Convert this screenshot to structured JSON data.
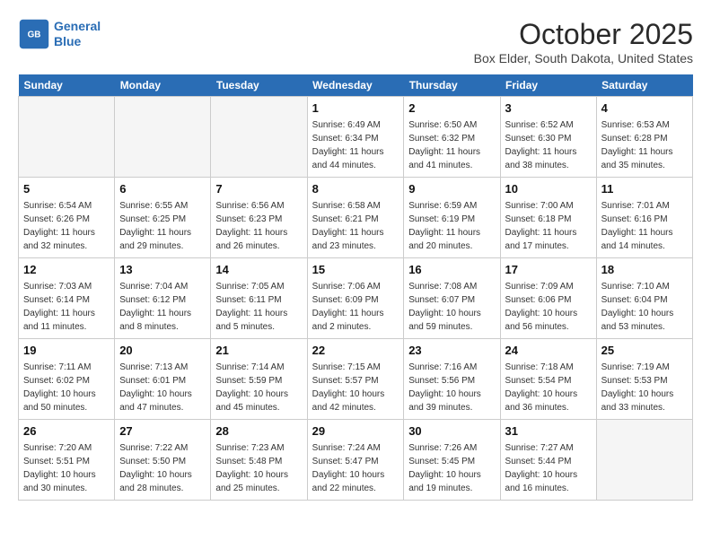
{
  "header": {
    "logo_line1": "General",
    "logo_line2": "Blue",
    "month": "October 2025",
    "location": "Box Elder, South Dakota, United States"
  },
  "weekdays": [
    "Sunday",
    "Monday",
    "Tuesday",
    "Wednesday",
    "Thursday",
    "Friday",
    "Saturday"
  ],
  "weeks": [
    [
      {
        "day": "",
        "info": ""
      },
      {
        "day": "",
        "info": ""
      },
      {
        "day": "",
        "info": ""
      },
      {
        "day": "1",
        "info": "Sunrise: 6:49 AM\nSunset: 6:34 PM\nDaylight: 11 hours\nand 44 minutes."
      },
      {
        "day": "2",
        "info": "Sunrise: 6:50 AM\nSunset: 6:32 PM\nDaylight: 11 hours\nand 41 minutes."
      },
      {
        "day": "3",
        "info": "Sunrise: 6:52 AM\nSunset: 6:30 PM\nDaylight: 11 hours\nand 38 minutes."
      },
      {
        "day": "4",
        "info": "Sunrise: 6:53 AM\nSunset: 6:28 PM\nDaylight: 11 hours\nand 35 minutes."
      }
    ],
    [
      {
        "day": "5",
        "info": "Sunrise: 6:54 AM\nSunset: 6:26 PM\nDaylight: 11 hours\nand 32 minutes."
      },
      {
        "day": "6",
        "info": "Sunrise: 6:55 AM\nSunset: 6:25 PM\nDaylight: 11 hours\nand 29 minutes."
      },
      {
        "day": "7",
        "info": "Sunrise: 6:56 AM\nSunset: 6:23 PM\nDaylight: 11 hours\nand 26 minutes."
      },
      {
        "day": "8",
        "info": "Sunrise: 6:58 AM\nSunset: 6:21 PM\nDaylight: 11 hours\nand 23 minutes."
      },
      {
        "day": "9",
        "info": "Sunrise: 6:59 AM\nSunset: 6:19 PM\nDaylight: 11 hours\nand 20 minutes."
      },
      {
        "day": "10",
        "info": "Sunrise: 7:00 AM\nSunset: 6:18 PM\nDaylight: 11 hours\nand 17 minutes."
      },
      {
        "day": "11",
        "info": "Sunrise: 7:01 AM\nSunset: 6:16 PM\nDaylight: 11 hours\nand 14 minutes."
      }
    ],
    [
      {
        "day": "12",
        "info": "Sunrise: 7:03 AM\nSunset: 6:14 PM\nDaylight: 11 hours\nand 11 minutes."
      },
      {
        "day": "13",
        "info": "Sunrise: 7:04 AM\nSunset: 6:12 PM\nDaylight: 11 hours\nand 8 minutes."
      },
      {
        "day": "14",
        "info": "Sunrise: 7:05 AM\nSunset: 6:11 PM\nDaylight: 11 hours\nand 5 minutes."
      },
      {
        "day": "15",
        "info": "Sunrise: 7:06 AM\nSunset: 6:09 PM\nDaylight: 11 hours\nand 2 minutes."
      },
      {
        "day": "16",
        "info": "Sunrise: 7:08 AM\nSunset: 6:07 PM\nDaylight: 10 hours\nand 59 minutes."
      },
      {
        "day": "17",
        "info": "Sunrise: 7:09 AM\nSunset: 6:06 PM\nDaylight: 10 hours\nand 56 minutes."
      },
      {
        "day": "18",
        "info": "Sunrise: 7:10 AM\nSunset: 6:04 PM\nDaylight: 10 hours\nand 53 minutes."
      }
    ],
    [
      {
        "day": "19",
        "info": "Sunrise: 7:11 AM\nSunset: 6:02 PM\nDaylight: 10 hours\nand 50 minutes."
      },
      {
        "day": "20",
        "info": "Sunrise: 7:13 AM\nSunset: 6:01 PM\nDaylight: 10 hours\nand 47 minutes."
      },
      {
        "day": "21",
        "info": "Sunrise: 7:14 AM\nSunset: 5:59 PM\nDaylight: 10 hours\nand 45 minutes."
      },
      {
        "day": "22",
        "info": "Sunrise: 7:15 AM\nSunset: 5:57 PM\nDaylight: 10 hours\nand 42 minutes."
      },
      {
        "day": "23",
        "info": "Sunrise: 7:16 AM\nSunset: 5:56 PM\nDaylight: 10 hours\nand 39 minutes."
      },
      {
        "day": "24",
        "info": "Sunrise: 7:18 AM\nSunset: 5:54 PM\nDaylight: 10 hours\nand 36 minutes."
      },
      {
        "day": "25",
        "info": "Sunrise: 7:19 AM\nSunset: 5:53 PM\nDaylight: 10 hours\nand 33 minutes."
      }
    ],
    [
      {
        "day": "26",
        "info": "Sunrise: 7:20 AM\nSunset: 5:51 PM\nDaylight: 10 hours\nand 30 minutes."
      },
      {
        "day": "27",
        "info": "Sunrise: 7:22 AM\nSunset: 5:50 PM\nDaylight: 10 hours\nand 28 minutes."
      },
      {
        "day": "28",
        "info": "Sunrise: 7:23 AM\nSunset: 5:48 PM\nDaylight: 10 hours\nand 25 minutes."
      },
      {
        "day": "29",
        "info": "Sunrise: 7:24 AM\nSunset: 5:47 PM\nDaylight: 10 hours\nand 22 minutes."
      },
      {
        "day": "30",
        "info": "Sunrise: 7:26 AM\nSunset: 5:45 PM\nDaylight: 10 hours\nand 19 minutes."
      },
      {
        "day": "31",
        "info": "Sunrise: 7:27 AM\nSunset: 5:44 PM\nDaylight: 10 hours\nand 16 minutes."
      },
      {
        "day": "",
        "info": ""
      }
    ]
  ]
}
